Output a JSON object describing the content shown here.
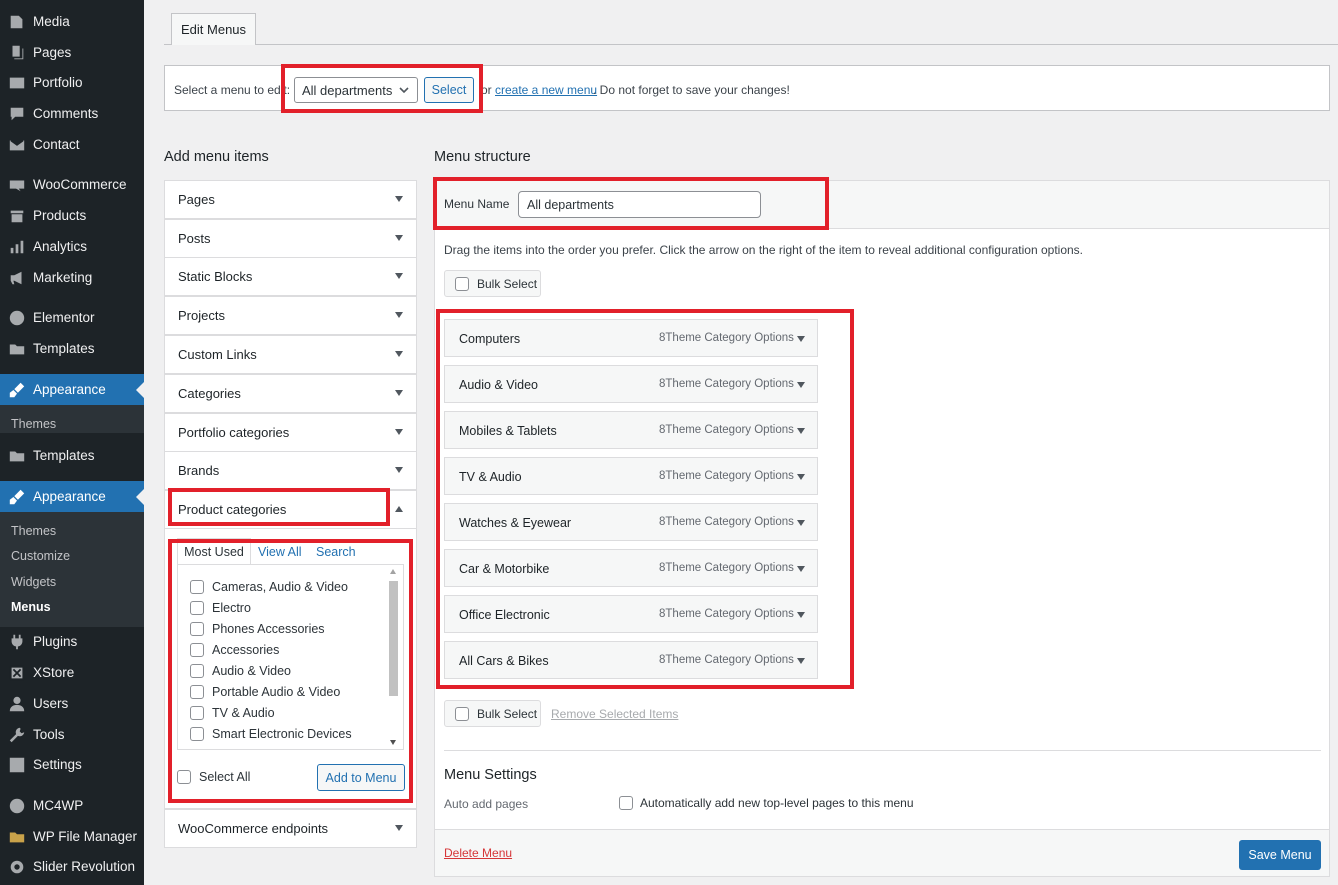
{
  "sidebar": {
    "items": [
      {
        "label": "Media",
        "icon": "media-icon"
      },
      {
        "label": "Pages",
        "icon": "pages-icon"
      },
      {
        "label": "Portfolio",
        "icon": "portfolio-icon"
      },
      {
        "label": "Comments",
        "icon": "comments-icon"
      },
      {
        "label": "Contact",
        "icon": "mail-icon"
      },
      {
        "label": "WooCommerce",
        "icon": "woocommerce-icon"
      },
      {
        "label": "Products",
        "icon": "products-icon"
      },
      {
        "label": "Analytics",
        "icon": "analytics-icon"
      },
      {
        "label": "Marketing",
        "icon": "megaphone-icon"
      },
      {
        "label": "Elementor",
        "icon": "elementor-icon"
      },
      {
        "label": "Templates",
        "icon": "folder-icon"
      },
      {
        "label": "Appearance",
        "icon": "brush-icon"
      },
      {
        "label": "Templates",
        "icon": "folder-icon"
      },
      {
        "label": "Appearance",
        "icon": "brush-icon"
      },
      {
        "label": "Plugins",
        "icon": "plugin-icon"
      },
      {
        "label": "XStore",
        "icon": "xstore-icon"
      },
      {
        "label": "Users",
        "icon": "users-icon"
      },
      {
        "label": "Tools",
        "icon": "wrench-icon"
      },
      {
        "label": "Settings",
        "icon": "settings-icon"
      },
      {
        "label": "MC4WP",
        "icon": "mc4wp-icon"
      },
      {
        "label": "WP File Manager",
        "icon": "file-manager-icon"
      },
      {
        "label": "Slider Revolution",
        "icon": "slider-icon"
      }
    ],
    "submenu1": [
      "Themes"
    ],
    "submenu2": [
      "Themes",
      "Customize",
      "Widgets",
      "Menus"
    ]
  },
  "tabs": {
    "edit_menus": "Edit Menus"
  },
  "manage": {
    "prefix": "Select a menu to edit:",
    "selected_menu": "All departments",
    "select_button": "Select",
    "or_text": "or",
    "create_link": "create a new menu",
    "suffix": ". Do not forget to save your changes!"
  },
  "add_items": {
    "title": "Add menu items",
    "sections": [
      "Pages",
      "Posts",
      "Static Blocks",
      "Projects",
      "Custom Links",
      "Categories",
      "Portfolio categories",
      "Brands",
      "Product categories",
      "WooCommerce endpoints"
    ],
    "tabs": {
      "most_used": "Most Used",
      "view_all": "View All",
      "search": "Search"
    },
    "product_categories": [
      "Cameras, Audio & Video",
      "Electro",
      "Phones Accessories",
      "Accessories",
      "Audio & Video",
      "Portable Audio & Video",
      "TV & Audio",
      "Smart Electronic Devices"
    ],
    "select_all": "Select All",
    "add_button": "Add to Menu"
  },
  "structure": {
    "title": "Menu structure",
    "menu_name_label": "Menu Name",
    "menu_name_value": "All departments",
    "help": "Drag the items into the order you prefer. Click the arrow on the right of the item to reveal additional configuration options.",
    "bulk_select": "Bulk Select",
    "items": [
      {
        "title": "Computers",
        "type": "8Theme Category Options"
      },
      {
        "title": "Audio & Video",
        "type": "8Theme Category Options"
      },
      {
        "title": "Mobiles & Tablets",
        "type": "8Theme Category Options"
      },
      {
        "title": "TV & Audio",
        "type": "8Theme Category Options"
      },
      {
        "title": "Watches & Eyewear",
        "type": "8Theme Category Options"
      },
      {
        "title": "Car & Motorbike",
        "type": "8Theme Category Options"
      },
      {
        "title": "Office Electronic",
        "type": "8Theme Category Options"
      },
      {
        "title": "All Cars & Bikes",
        "type": "8Theme Category Options"
      }
    ],
    "remove_selected": "Remove Selected Items",
    "settings_title": "Menu Settings",
    "auto_add_label": "Auto add pages",
    "auto_add_option": "Automatically add new top-level pages to this menu",
    "delete_menu": "Delete Menu",
    "save_menu": "Save Menu"
  },
  "colors": {
    "accent": "#2271b1",
    "highlight": "#e2202a",
    "sidebar_bg": "#1d2327"
  }
}
